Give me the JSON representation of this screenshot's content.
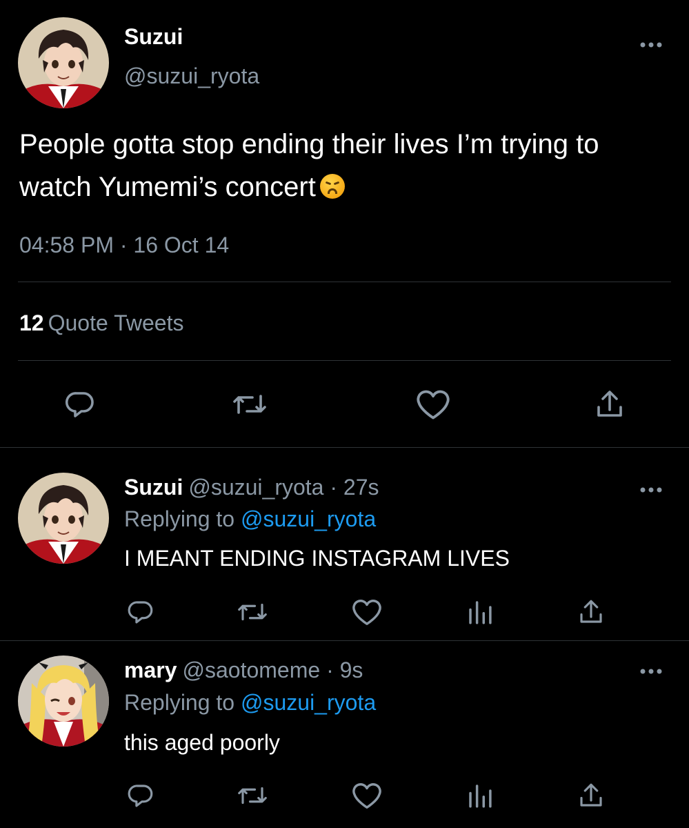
{
  "main_tweet": {
    "author_name": "Suzui",
    "handle": "@suzui_ryota",
    "text": "People gotta stop ending their lives I’m trying to watch Yumemi’s concert",
    "emoji": "weary-face-emoji",
    "timestamp": "04:58 PM · 16 Oct 14",
    "quote_count": "12",
    "quote_label": "Quote Tweets",
    "actions": [
      "reply-icon",
      "retweet-icon",
      "like-icon",
      "share-icon"
    ]
  },
  "replies": [
    {
      "author_name": "Suzui",
      "meta": "@suzui_ryota · 27s",
      "replying_prefix": "Replying to",
      "replying_to": "@suzui_ryota",
      "text": "I MEANT ENDING INSTAGRAM LIVES",
      "actions": [
        "reply-icon",
        "retweet-icon",
        "like-icon",
        "analytics-icon",
        "share-icon"
      ]
    },
    {
      "author_name": "mary",
      "meta": "@saotomeme · 9s",
      "replying_prefix": "Replying to",
      "replying_to": "@suzui_ryota",
      "text": "this aged poorly",
      "actions": [
        "reply-icon",
        "retweet-icon",
        "like-icon",
        "analytics-icon",
        "share-icon"
      ]
    }
  ],
  "colors": {
    "background": "#000000",
    "text_primary": "#ffffff",
    "text_secondary": "#8b98a5",
    "link": "#1d9bf0",
    "divider": "#2f3336"
  }
}
